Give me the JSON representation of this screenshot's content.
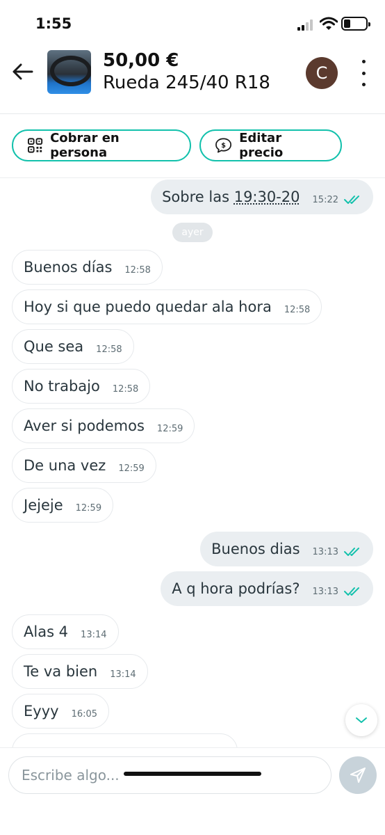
{
  "status_bar": {
    "time": "1:55",
    "icons": [
      "signal-icon",
      "wifi-icon",
      "battery-icon"
    ],
    "battery_level": 0.3
  },
  "header": {
    "price": "50,00 €",
    "title": "Rueda 245/40 R18",
    "avatar_initial": "C",
    "icons": [
      "back-arrow-icon",
      "more-vertical-icon"
    ]
  },
  "actions": {
    "cobrar_label": "Cobrar en persona",
    "editar_label": "Editar precio"
  },
  "chat": {
    "day_separator": "ayer",
    "messages": [
      {
        "dir": "out",
        "text_before": "Sobre las ",
        "text_link": "19:30-20",
        "time": "15:22",
        "read": true
      },
      {
        "dir": "in",
        "text": "Buenos días",
        "time": "12:58"
      },
      {
        "dir": "in",
        "text": "Hoy si que puedo quedar ala hora",
        "time": "12:58"
      },
      {
        "dir": "in",
        "text": "Que sea",
        "time": "12:58"
      },
      {
        "dir": "in",
        "text": "No trabajo",
        "time": "12:58"
      },
      {
        "dir": "in",
        "text": "Aver si podemos",
        "time": "12:59"
      },
      {
        "dir": "in",
        "text": "De una vez",
        "time": "12:59"
      },
      {
        "dir": "in",
        "text": "Jejeje",
        "time": "12:59"
      },
      {
        "dir": "out",
        "text": "Buenos dias",
        "time": "13:13",
        "read": true
      },
      {
        "dir": "out",
        "text": "A q hora podrías?",
        "time": "13:13",
        "read": true
      },
      {
        "dir": "in",
        "text": "Alas 4",
        "time": "13:14"
      },
      {
        "dir": "in",
        "text": "Te va bien",
        "time": "13:14"
      },
      {
        "dir": "in",
        "text": "Eyyy",
        "time": "16:05"
      }
    ]
  },
  "composer": {
    "placeholder": "Escribe algo..."
  },
  "colors": {
    "accent": "#13c1ac",
    "outgoing_bubble": "#eaeef1",
    "avatar_bg": "#5b3a2e",
    "send_button": "#c8d3da"
  }
}
